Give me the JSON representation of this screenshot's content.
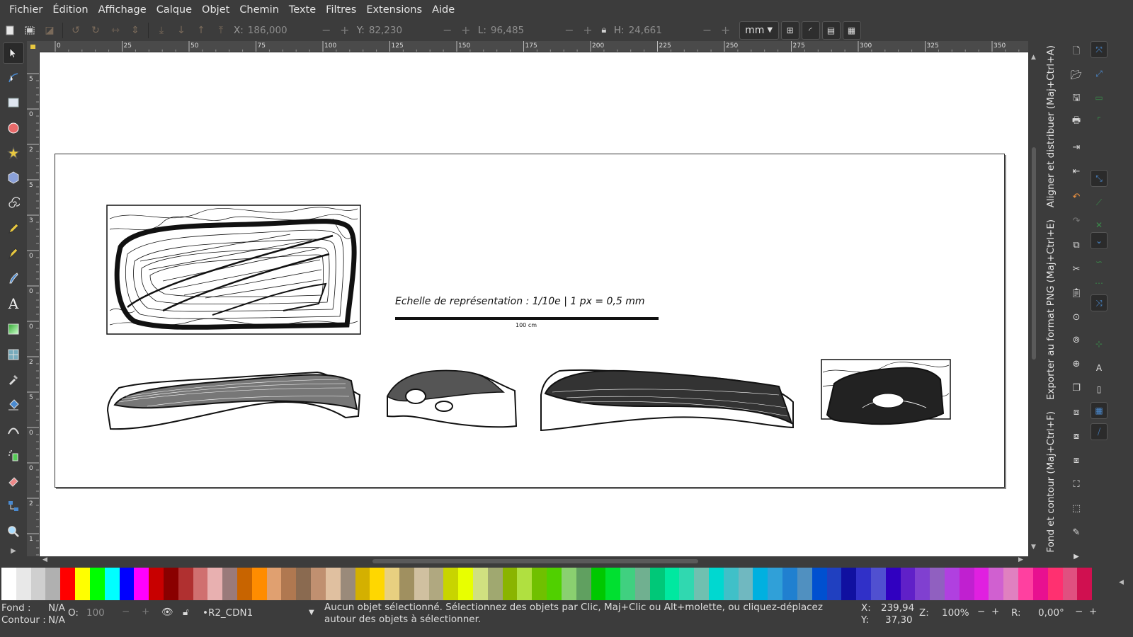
{
  "menubar": {
    "items": [
      "Fichier",
      "Édition",
      "Affichage",
      "Calque",
      "Objet",
      "Chemin",
      "Texte",
      "Filtres",
      "Extensions",
      "Aide"
    ]
  },
  "controls": {
    "x_label": "X:",
    "x_value": "186,000",
    "y_label": "Y:",
    "y_value": "82,230",
    "w_label": "L:",
    "w_value": "96,485",
    "h_label": "H:",
    "h_value": "24,661",
    "unit": "mm",
    "minus": "−",
    "plus": "+"
  },
  "rulers": {
    "horizontal_ticks": [
      "0",
      "25",
      "50",
      "75",
      "100",
      "125",
      "150",
      "175",
      "200",
      "225",
      "250",
      "275",
      "300",
      "325",
      "350"
    ],
    "vertical_ticks": [
      "5",
      "0",
      "2",
      "5",
      "3",
      "0",
      "0",
      "0",
      "2",
      "5",
      "0",
      "0",
      "2",
      "1"
    ]
  },
  "canvas": {
    "scale_caption": "Echelle de représentation : 1/10e | 1 px = 0,5 mm",
    "scale_bar_label": "100 cm",
    "page_background": "#ffffff"
  },
  "dock": {
    "tab_align": "Aligner et distribuer (Maj+Ctrl+A)",
    "tab_export": "Exporter au format PNG (Maj+Ctrl+E)",
    "tab_fill": "Fond et contour (Maj+Ctrl+F)"
  },
  "palette": {
    "colors": [
      "#ffffff",
      "#e8e8e8",
      "#cfcfcf",
      "#b0b0b0",
      "#ff0000",
      "#ffff00",
      "#00ff00",
      "#00ffff",
      "#0000ff",
      "#ff00ff",
      "#c80000",
      "#8a0000",
      "#b03030",
      "#d07070",
      "#e8b0b0",
      "#9a7a7a",
      "#c86400",
      "#ff8c00",
      "#e0a070",
      "#b07850",
      "#8a6a50",
      "#c09070",
      "#e0c0a0",
      "#9a8a7a",
      "#d4b000",
      "#ffd700",
      "#e8d080",
      "#a09060",
      "#d0c0a0",
      "#b0a880",
      "#c8d400",
      "#e8ff00",
      "#d0e080",
      "#a0a870",
      "#8ab400",
      "#b0e040",
      "#70c000",
      "#50d000",
      "#8ad070",
      "#60a060",
      "#00c800",
      "#00e030",
      "#40d080",
      "#70b090",
      "#00c878",
      "#00e8a0",
      "#30d8b0",
      "#70c0b0",
      "#00d8d0",
      "#40c0c8",
      "#70b8c0",
      "#00b0e0",
      "#30a0d8",
      "#2080d0",
      "#5090c0",
      "#0050d0",
      "#2040c0",
      "#1010a0",
      "#3030c8",
      "#5050d0",
      "#3000c0",
      "#6020c8",
      "#8040d0",
      "#9060c0",
      "#b040e0",
      "#c020d0",
      "#e020e0",
      "#d060d0",
      "#e080c0",
      "#ff40a0",
      "#e81090",
      "#ff3070",
      "#e05080",
      "#d01050"
    ]
  },
  "status": {
    "fill_label": "Fond :",
    "fill_value": "N/A",
    "stroke_label": "Contour :",
    "stroke_value": "N/A",
    "opacity_label": "O:",
    "opacity_value": "100",
    "layer": "•R2_CDN1",
    "message": "Aucun objet sélectionné. Sélectionnez des objets par Clic, Maj+Clic ou Alt+molette, ou cliquez-déplacez autour des objets à sélectionner.",
    "cursor_x_label": "X:",
    "cursor_x": "239,94",
    "cursor_y_label": "Y:",
    "cursor_y": "37,30",
    "zoom_label": "Z:",
    "zoom": "100%",
    "rotation_label": "R:",
    "rotation": "0,00°"
  }
}
